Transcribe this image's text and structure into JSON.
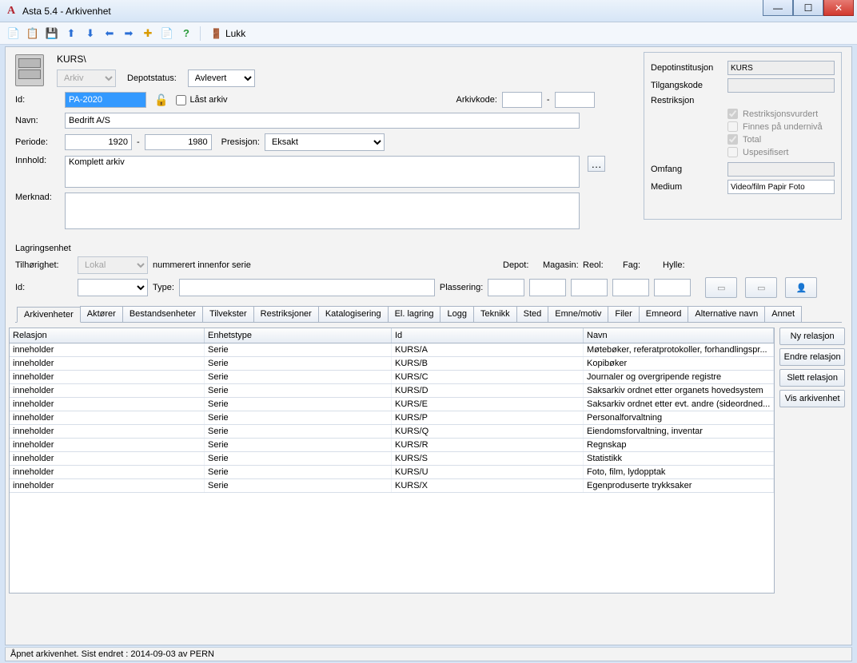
{
  "window": {
    "title": "Asta 5.4 - Arkivenhet"
  },
  "toolbar": {
    "close_label": "Lukk"
  },
  "header": {
    "breadcrumb": "KURS\\",
    "arkiv_select": "Arkiv",
    "depotstatus_label": "Depotstatus:",
    "depotstatus_value": "Avlevert"
  },
  "labels": {
    "id": "Id:",
    "navn": "Navn:",
    "periode": "Periode:",
    "presisjon": "Presisjon:",
    "innhold": "Innhold:",
    "merknad": "Merknad:",
    "arkivkode": "Arkivkode:",
    "dash": "-"
  },
  "fields": {
    "id": "PA-2020",
    "laast_label": "Låst arkiv",
    "navn": "Bedrift A/S",
    "periode_from": "1920",
    "periode_to": "1980",
    "presisjon": "Eksakt",
    "innhold": "Komplett arkiv",
    "merknad": "",
    "arkivkode1": "",
    "arkivkode2": ""
  },
  "right": {
    "depotinst_label": "Depotinstitusjon",
    "depotinst_value": "KURS",
    "tilgang_label": "Tilgangskode",
    "tilgang_value": "",
    "restrik_label": "Restriksjon",
    "chk1": "Restriksjonsvurdert",
    "chk2": "Finnes på undernivå",
    "chk3": "Total",
    "chk4": "Uspesifisert",
    "omfang_label": "Omfang",
    "omfang_value": "",
    "medium_label": "Medium",
    "medium_value": "Video/film Papir Foto"
  },
  "storage": {
    "title": "Lagringsenhet",
    "tilhor_label": "Tilhørighet:",
    "tilhor_value": "Lokal",
    "numbered": "nummerert innenfor serie",
    "id_label": "Id:",
    "type_label": "Type:",
    "plassering_label": "Plassering:",
    "depot": "Depot:",
    "magasin": "Magasin:",
    "reol": "Reol:",
    "fag": "Fag:",
    "hylle": "Hylle:"
  },
  "tabs": [
    "Arkivenheter",
    "Aktører",
    "Bestandsenheter",
    "Tilvekster",
    "Restriksjoner",
    "Katalogisering",
    "El. lagring",
    "Logg",
    "Teknikk",
    "Sted",
    "Emne/motiv",
    "Filer",
    "Emneord",
    "Alternative navn",
    "Annet"
  ],
  "grid": {
    "headers": {
      "rel": "Relasjon",
      "type": "Enhetstype",
      "id": "Id",
      "navn": "Navn"
    },
    "rows": [
      {
        "rel": "inneholder",
        "type": "Serie",
        "id": "KURS/A",
        "navn": "Møtebøker, referatprotokoller, forhandlingspr..."
      },
      {
        "rel": "inneholder",
        "type": "Serie",
        "id": "KURS/B",
        "navn": "Kopibøker"
      },
      {
        "rel": "inneholder",
        "type": "Serie",
        "id": "KURS/C",
        "navn": "Journaler og overgripende registre"
      },
      {
        "rel": "inneholder",
        "type": "Serie",
        "id": "KURS/D",
        "navn": "Saksarkiv ordnet etter organets hovedsystem"
      },
      {
        "rel": "inneholder",
        "type": "Serie",
        "id": "KURS/E",
        "navn": "Saksarkiv ordnet etter evt. andre (sideordned..."
      },
      {
        "rel": "inneholder",
        "type": "Serie",
        "id": "KURS/P",
        "navn": "Personalforvaltning"
      },
      {
        "rel": "inneholder",
        "type": "Serie",
        "id": "KURS/Q",
        "navn": "Eiendomsforvaltning, inventar"
      },
      {
        "rel": "inneholder",
        "type": "Serie",
        "id": "KURS/R",
        "navn": "Regnskap"
      },
      {
        "rel": "inneholder",
        "type": "Serie",
        "id": "KURS/S",
        "navn": "Statistikk"
      },
      {
        "rel": "inneholder",
        "type": "Serie",
        "id": "KURS/U",
        "navn": "Foto, film, lydopptak"
      },
      {
        "rel": "inneholder",
        "type": "Serie",
        "id": "KURS/X",
        "navn": "Egenproduserte trykksaker"
      }
    ]
  },
  "side_buttons": {
    "new": "Ny relasjon",
    "edit": "Endre relasjon",
    "delete": "Slett relasjon",
    "show": "Vis arkivenhet"
  },
  "status": "Åpnet arkivenhet. Sist endret : 2014-09-03 av PERN"
}
